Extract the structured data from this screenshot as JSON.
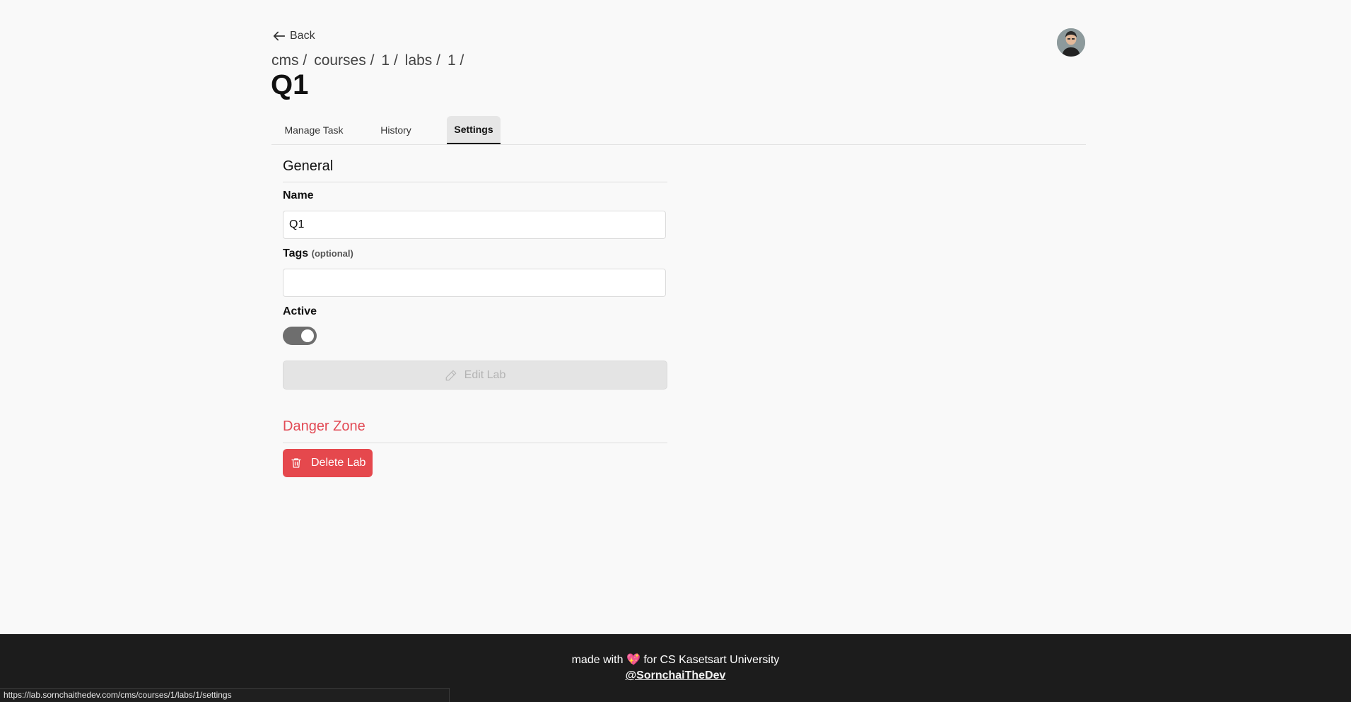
{
  "nav": {
    "back_label": "Back"
  },
  "breadcrumb": [
    {
      "label": "cms",
      "sep": "/"
    },
    {
      "label": "courses",
      "sep": "/"
    },
    {
      "label": "1",
      "sep": "/"
    },
    {
      "label": "labs",
      "sep": "/"
    },
    {
      "label": "1",
      "sep": "/"
    }
  ],
  "page": {
    "title": "Q1"
  },
  "tabs": [
    {
      "label": "Manage Task",
      "active": false
    },
    {
      "label": "History",
      "active": false
    },
    {
      "label": "Settings",
      "active": true
    }
  ],
  "general": {
    "title": "General",
    "name_label": "Name",
    "name_value": "Q1",
    "tags_label": "Tags",
    "tags_optional": "(optional)",
    "tags_value": "",
    "active_label": "Active",
    "active_on": true,
    "edit_button": "Edit Lab"
  },
  "danger": {
    "title": "Danger Zone",
    "delete_button": "Delete Lab"
  },
  "footer": {
    "made_with_prefix": "made with",
    "made_with_suffix": "for CS Kasetsart University",
    "author": "@SornchaiTheDev"
  },
  "status_bar": {
    "url": "https://lab.sornchaithedev.com/cms/courses/1/labs/1/settings"
  },
  "colors": {
    "danger": "#e5484d",
    "footer_bg": "#1c1c1c",
    "toggle_on": "#6e6e6e"
  },
  "icons": {
    "back": "arrow-left-icon",
    "edit": "pencil-icon",
    "delete": "trash-icon",
    "heart": "sparkling-heart-icon"
  }
}
